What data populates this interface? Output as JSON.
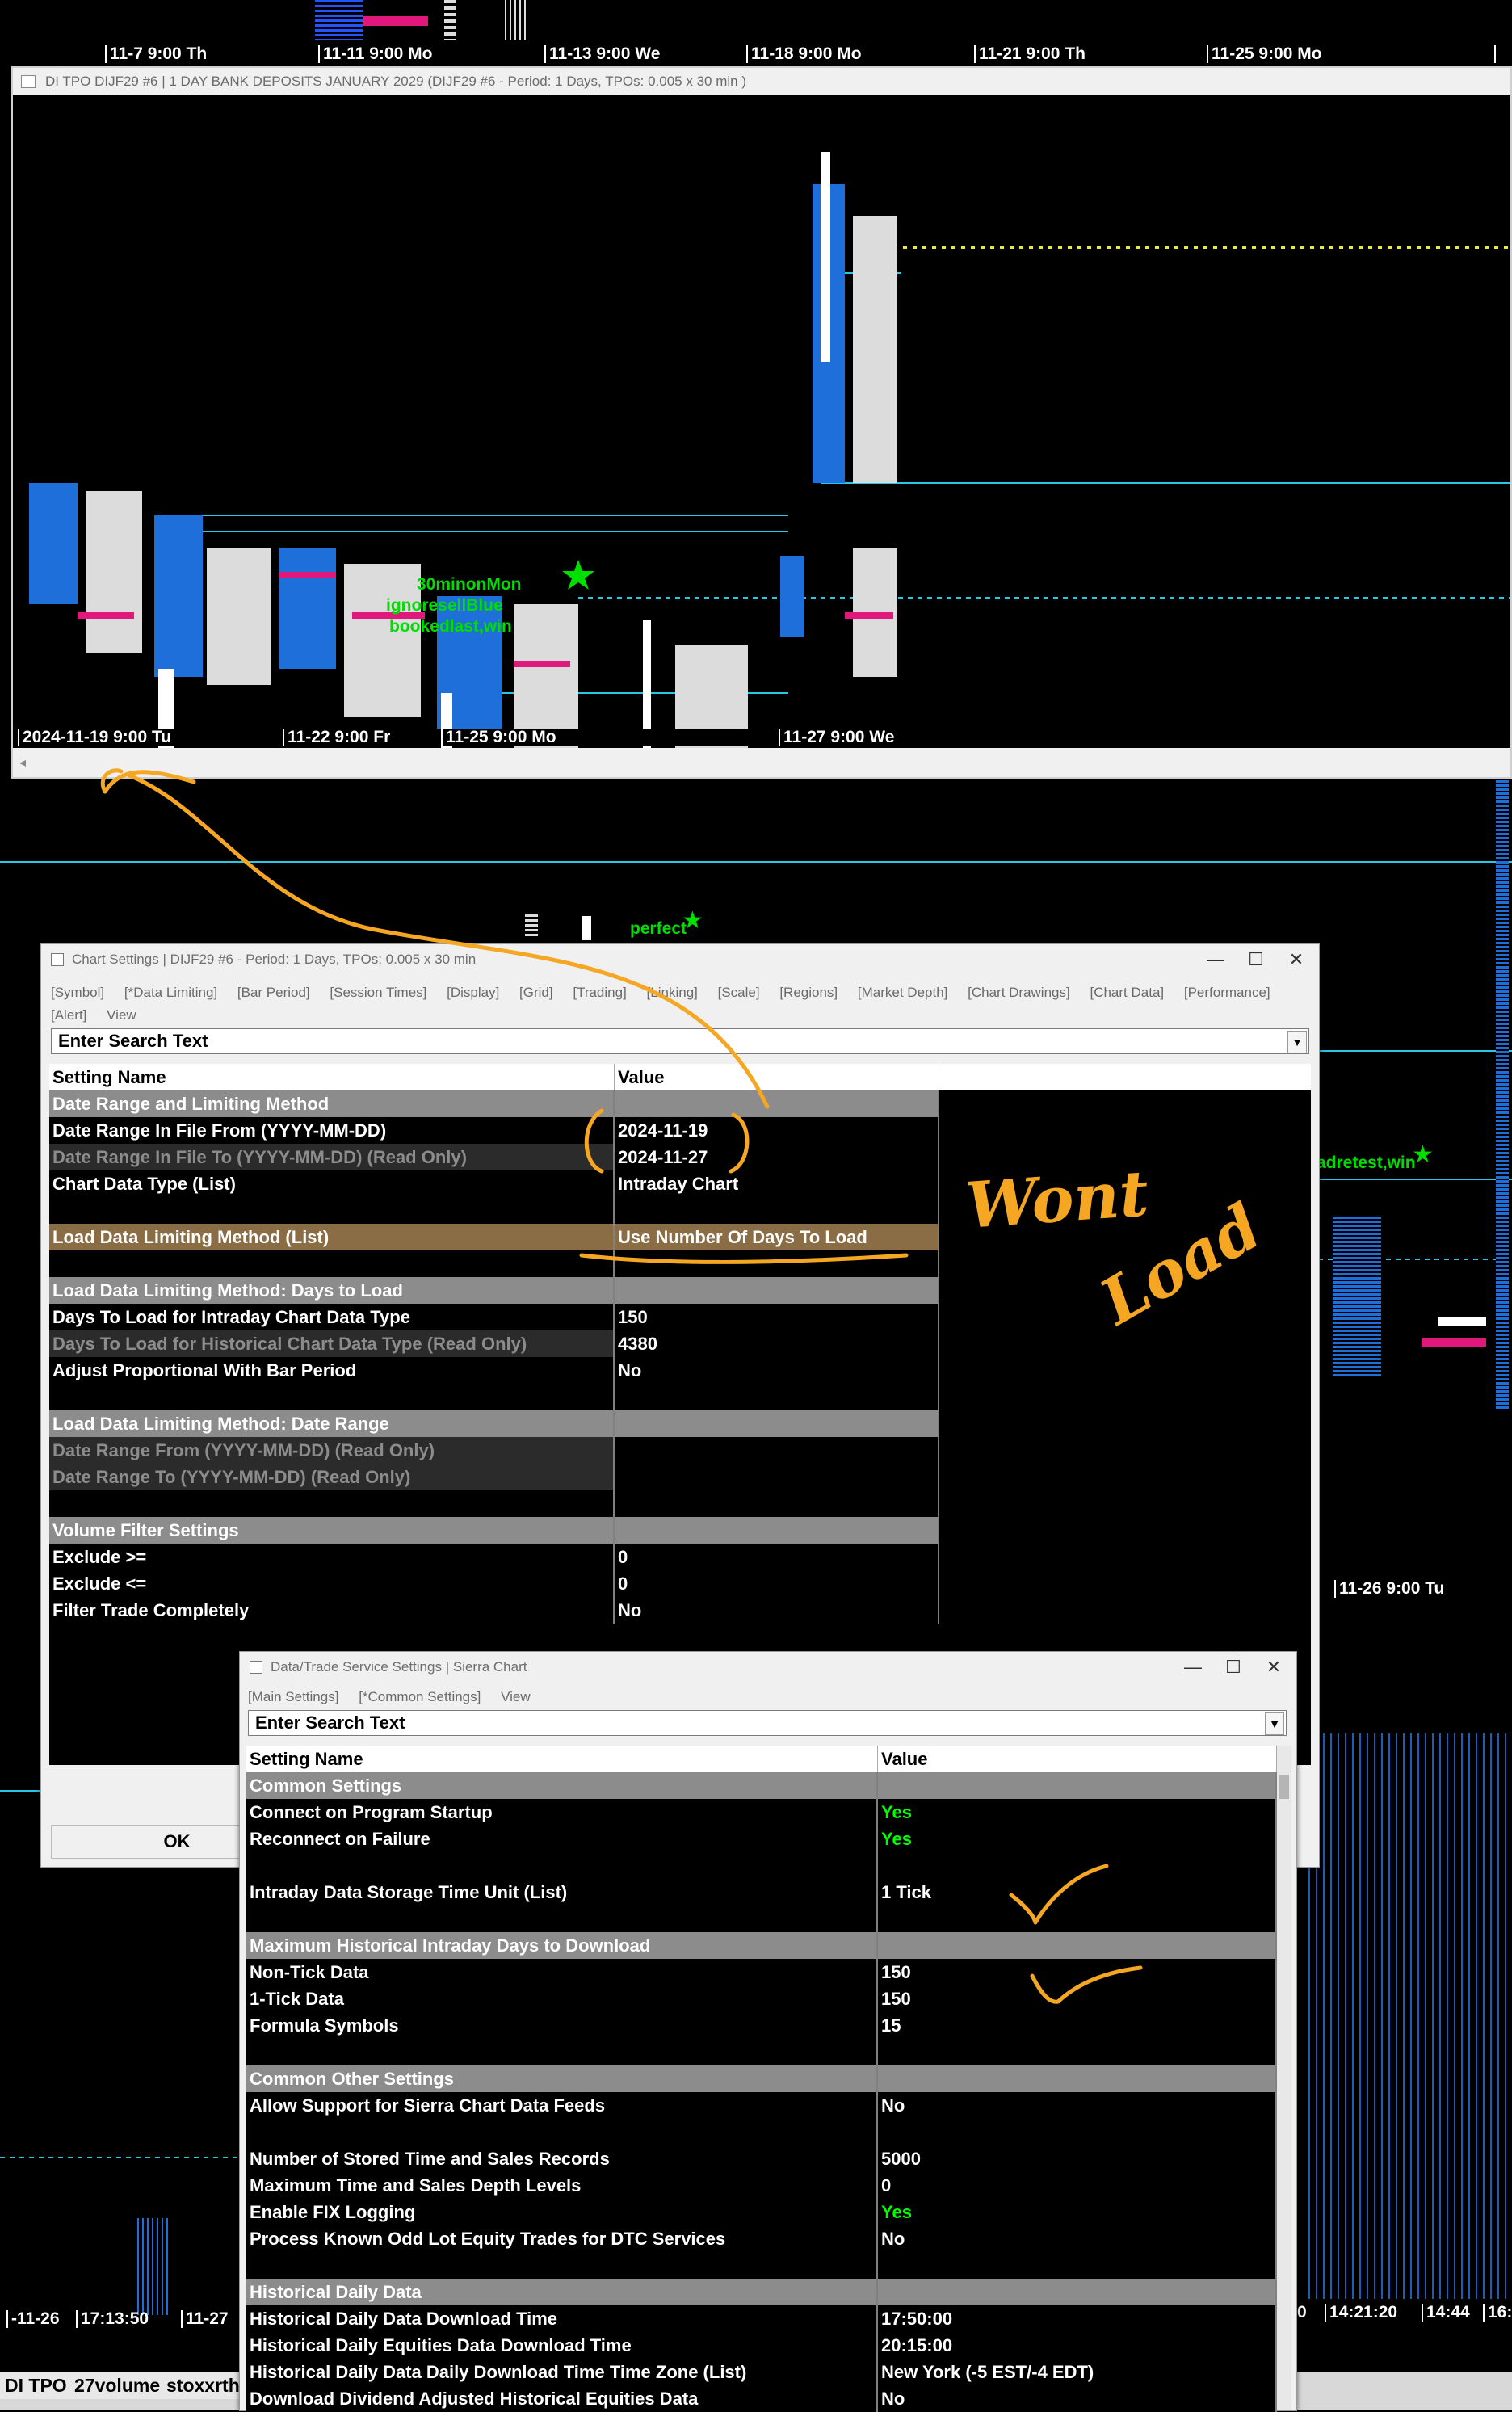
{
  "top_time_axis": [
    "11-7  9:00 Th",
    "11-11  9:00 Mo",
    "11-13  9:00 We",
    "11-18  9:00 Mo",
    "11-21  9:00 Th",
    "11-25  9:00 Mo"
  ],
  "chart_window": {
    "title": "DI TPO DIJF29 #6 | 1 DAY BANK DEPOSITS JANUARY 2029 (DIJF29 #6 - Period: 1 Days, TPOs: 0.005 x 30 min  )",
    "time_axis": [
      "2024-11-19  9:00 Tu",
      "11-22  9:00 Fr",
      "11-25  9:00 Mo",
      "11-27  9:00 We"
    ],
    "annotations": [
      "30minonMon",
      "ignoresellBlue",
      "bookedlast,win"
    ]
  },
  "background_labels": {
    "perfect": "perfect",
    "adretest": "adretest,win",
    "mid_time": "11-26  9:00 Tu",
    "bottom_left_times": [
      "-11-26",
      "17:13:50",
      "11-27"
    ],
    "bottom_right_times": [
      "0",
      "14:21:20",
      "14:44",
      "16:"
    ]
  },
  "chart_settings": {
    "title": "Chart Settings | DIJF29 #6 - Period: 1 Days, TPOs: 0.005 x 30 min",
    "menu": [
      "[Symbol]",
      "[*Data Limiting]",
      "[Bar Period]",
      "[Session Times]",
      "[Display]",
      "[Grid]",
      "[Trading]",
      "[Linking]",
      "[Scale]",
      "[Regions]",
      "[Market Depth]",
      "[Chart Drawings]",
      "[Chart Data]",
      "[Performance]"
    ],
    "menu2": [
      "[Alert]",
      "View"
    ],
    "search_placeholder": "Enter Search Text",
    "header": {
      "name": "Setting Name",
      "value": "Value"
    },
    "rows": [
      {
        "type": "grp",
        "name": "Date Range and Limiting Method",
        "value": ""
      },
      {
        "type": "norm",
        "name": "Date Range In File From (YYYY-MM-DD)",
        "value": "2024-11-19"
      },
      {
        "type": "ro",
        "name": "Date Range In File To (YYYY-MM-DD) (Read Only)",
        "value": "2024-11-27"
      },
      {
        "type": "norm",
        "name": "Chart Data Type (List)",
        "value": "Intraday Chart"
      },
      {
        "type": "blank",
        "name": "",
        "value": ""
      },
      {
        "type": "sel",
        "name": "Load Data Limiting Method (List)",
        "value": "Use Number Of Days To Load"
      },
      {
        "type": "blank",
        "name": "",
        "value": ""
      },
      {
        "type": "grp",
        "name": "Load Data Limiting Method: Days to Load",
        "value": ""
      },
      {
        "type": "norm",
        "name": "Days To Load for Intraday Chart Data Type",
        "value": "150"
      },
      {
        "type": "ro",
        "name": "Days To Load for Historical Chart Data Type (Read Only)",
        "value": "4380"
      },
      {
        "type": "norm",
        "name": "Adjust Proportional With Bar Period",
        "value": "No"
      },
      {
        "type": "blank",
        "name": "",
        "value": ""
      },
      {
        "type": "grp",
        "name": "Load Data Limiting Method: Date Range",
        "value": ""
      },
      {
        "type": "ro",
        "name": "Date Range From (YYYY-MM-DD) (Read Only)",
        "value": ""
      },
      {
        "type": "ro",
        "name": "Date Range To (YYYY-MM-DD) (Read Only)",
        "value": ""
      },
      {
        "type": "blank",
        "name": "",
        "value": ""
      },
      {
        "type": "grp",
        "name": "Volume Filter Settings",
        "value": ""
      },
      {
        "type": "norm",
        "name": "Exclude >=",
        "value": "0"
      },
      {
        "type": "norm",
        "name": "Exclude <=",
        "value": "0"
      },
      {
        "type": "norm",
        "name": "Filter Trade Completely",
        "value": "No"
      }
    ],
    "ok_label": "OK"
  },
  "data_trade_settings": {
    "title": "Data/Trade Service Settings | Sierra Chart",
    "menu": [
      "[Main Settings]",
      "[*Common Settings]",
      "View"
    ],
    "search_placeholder": "Enter Search Text",
    "header": {
      "name": "Setting Name",
      "value": "Value"
    },
    "rows": [
      {
        "type": "grp",
        "name": "Common Settings",
        "value": "",
        "green": false
      },
      {
        "type": "norm",
        "name": "Connect on Program Startup",
        "value": "Yes",
        "green": true
      },
      {
        "type": "norm",
        "name": "Reconnect on Failure",
        "value": "Yes",
        "green": true
      },
      {
        "type": "blank",
        "name": "",
        "value": "",
        "green": false
      },
      {
        "type": "norm",
        "name": "Intraday Data Storage Time Unit (List)",
        "value": "1 Tick",
        "green": false
      },
      {
        "type": "blank",
        "name": "",
        "value": "",
        "green": false
      },
      {
        "type": "grp",
        "name": "Maximum Historical Intraday Days to Download",
        "value": "",
        "green": false
      },
      {
        "type": "norm",
        "name": "Non-Tick Data",
        "value": "150",
        "green": false
      },
      {
        "type": "norm",
        "name": "1-Tick Data",
        "value": "150",
        "green": false
      },
      {
        "type": "norm",
        "name": "Formula Symbols",
        "value": "15",
        "green": false
      },
      {
        "type": "blank",
        "name": "",
        "value": "",
        "green": false
      },
      {
        "type": "grp",
        "name": "Common Other Settings",
        "value": "",
        "green": false
      },
      {
        "type": "norm",
        "name": "Allow Support for Sierra Chart Data Feeds",
        "value": "No",
        "green": false
      },
      {
        "type": "blank",
        "name": "",
        "value": "",
        "green": false
      },
      {
        "type": "norm",
        "name": "Number of Stored Time and Sales Records",
        "value": "5000",
        "green": false
      },
      {
        "type": "norm",
        "name": "Maximum Time and Sales Depth Levels",
        "value": "0",
        "green": false
      },
      {
        "type": "norm",
        "name": "Enable FIX Logging",
        "value": "Yes",
        "green": true
      },
      {
        "type": "norm",
        "name": "Process Known Odd Lot Equity Trades for DTC Services",
        "value": "No",
        "green": false
      },
      {
        "type": "blank",
        "name": "",
        "value": "",
        "green": false
      },
      {
        "type": "grp",
        "name": "Historical Daily Data",
        "value": "",
        "green": false
      },
      {
        "type": "norm",
        "name": "Historical Daily Data Download Time",
        "value": "17:50:00",
        "green": false
      },
      {
        "type": "norm",
        "name": "Historical Daily Equities Data Download Time",
        "value": "20:15:00",
        "green": false
      },
      {
        "type": "norm",
        "name": "Historical Daily Data Daily Download Time Time Zone (List)",
        "value": "New York (-5 EST/-4 EDT)",
        "green": false
      },
      {
        "type": "norm",
        "name": "Download Dividend Adjusted Historical Equities Data",
        "value": "No",
        "green": false
      }
    ]
  },
  "handwritten": {
    "wont": "Wont",
    "load": "Load"
  },
  "bottom_tabs": [
    "DI TPO",
    "27volume",
    "stoxxrth"
  ],
  "colors": {
    "annotation": "#f5a623",
    "cyan": "#29c6e6",
    "tpo_blue": "#1e6fd9",
    "group_gray": "#8c8c8c",
    "selected": "#8a6d45"
  }
}
